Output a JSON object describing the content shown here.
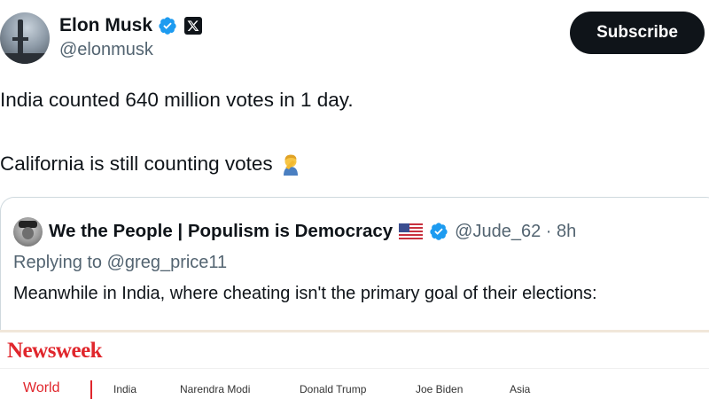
{
  "author": {
    "name": "Elon Musk",
    "handle": "@elonmusk"
  },
  "subscribe_label": "Subscribe",
  "tweet": {
    "line1": "India counted 640 million votes in 1 day.",
    "line2": "California is still counting votes"
  },
  "quote": {
    "name": "We the People | Populism is Democracy",
    "handle_time": "@Jude_62 · 8h",
    "replying_to": "Replying to @greg_price11",
    "text": "Meanwhile in India, where cheating isn't the primary goal of their elections:"
  },
  "newsweek": {
    "logo": "Newsweek",
    "nav": {
      "world": "World",
      "items": [
        "India",
        "Narendra Modi",
        "Donald Trump",
        "Joe Biden",
        "Asia"
      ]
    }
  },
  "colors": {
    "verified": "#1d9bf0",
    "newsweek_red": "#e0262c",
    "text_primary": "#0f1419",
    "text_secondary": "#536471"
  },
  "icons": [
    "verified-badge-icon",
    "x-logo-icon",
    "person-facepalming-emoji",
    "us-flag-icon"
  ]
}
